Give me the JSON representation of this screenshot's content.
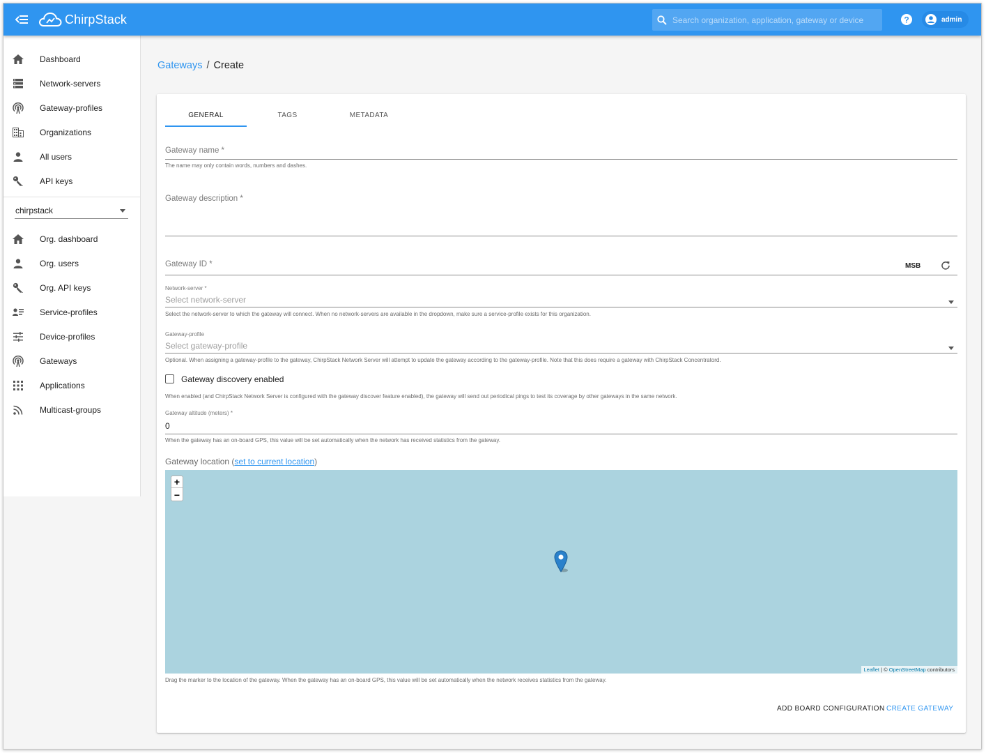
{
  "app": {
    "name": "ChirpStack"
  },
  "colors": {
    "primary": "#2f95f0",
    "map_water": "#abd3df"
  },
  "topbar": {
    "search_placeholder": "Search organization, application, gateway or device",
    "user": "admin",
    "icons": {
      "menu": "menu-collapse-icon",
      "search": "search-icon",
      "help": "help-circle-icon",
      "account": "account-circle-icon"
    }
  },
  "sidebar": {
    "items": [
      {
        "label": "Dashboard",
        "icon": "home-icon"
      },
      {
        "label": "Network-servers",
        "icon": "server-icon"
      },
      {
        "label": "Gateway-profiles",
        "icon": "radio-tower-icon"
      },
      {
        "label": "Organizations",
        "icon": "domain-icon"
      },
      {
        "label": "All users",
        "icon": "account-icon"
      },
      {
        "label": "API keys",
        "icon": "key-icon"
      }
    ],
    "org_select": "chirpstack",
    "org_items": [
      {
        "label": "Org. dashboard",
        "icon": "home-icon"
      },
      {
        "label": "Org. users",
        "icon": "account-icon"
      },
      {
        "label": "Org. API keys",
        "icon": "key-icon"
      },
      {
        "label": "Service-profiles",
        "icon": "account-details-icon"
      },
      {
        "label": "Device-profiles",
        "icon": "tune-icon"
      },
      {
        "label": "Gateways",
        "icon": "radio-tower-icon"
      },
      {
        "label": "Applications",
        "icon": "apps-icon"
      },
      {
        "label": "Multicast-groups",
        "icon": "rss-icon"
      }
    ]
  },
  "breadcrumb": {
    "parent": "Gateways",
    "separator": "/",
    "current": "Create"
  },
  "tabs": [
    {
      "label": "GENERAL",
      "active": true
    },
    {
      "label": "TAGS",
      "active": false
    },
    {
      "label": "METADATA",
      "active": false
    }
  ],
  "form": {
    "name": {
      "label": "Gateway name *",
      "helper": "The name may only contain words, numbers and dashes.",
      "value": ""
    },
    "description": {
      "label": "Gateway description *",
      "value": ""
    },
    "gateway_id": {
      "label": "Gateway ID *",
      "byte_order": "MSB",
      "refresh_icon": "refresh-icon",
      "value": ""
    },
    "network_server": {
      "label": "Network-server *",
      "placeholder": "Select network-server",
      "helper": "Select the network-server to which the gateway will connect. When no network-servers are available in the dropdown, make sure a service-profile exists for this organization."
    },
    "gateway_profile": {
      "label": "Gateway-profile",
      "placeholder": "Select gateway-profile",
      "helper": "Optional. When assigning a gateway-profile to the gateway, ChirpStack Network Server will attempt to update the gateway according to the gateway-profile. Note that this does require a gateway with ChirpStack Concentratord."
    },
    "discovery": {
      "label": "Gateway discovery enabled",
      "checked": false,
      "helper": "When enabled (and ChirpStack Network Server is configured with the gateway discover feature enabled), the gateway will send out periodical pings to test its coverage by other gateways in the same network."
    },
    "altitude": {
      "label": "Gateway altitude (meters) *",
      "value": "0",
      "helper": "When the gateway has an on-board GPS, this value will be set automatically when the network has received statistics from the gateway."
    },
    "location": {
      "label": "Gateway location (",
      "link": "set to current location",
      "label_end": ")",
      "helper": "Drag the marker to the location of the gateway. When the gateway has an on-board GPS, this value will be set automatically when the network receives statistics from the gateway.",
      "zoom_in": "+",
      "zoom_out": "−",
      "attribution_leaflet": "Leaflet",
      "attribution_sep": " | © ",
      "attribution_osm": "OpenStreetMap",
      "attribution_end": " contributors"
    }
  },
  "actions": {
    "add_board": "ADD BOARD CONFIGURATION",
    "create": "CREATE GATEWAY"
  }
}
